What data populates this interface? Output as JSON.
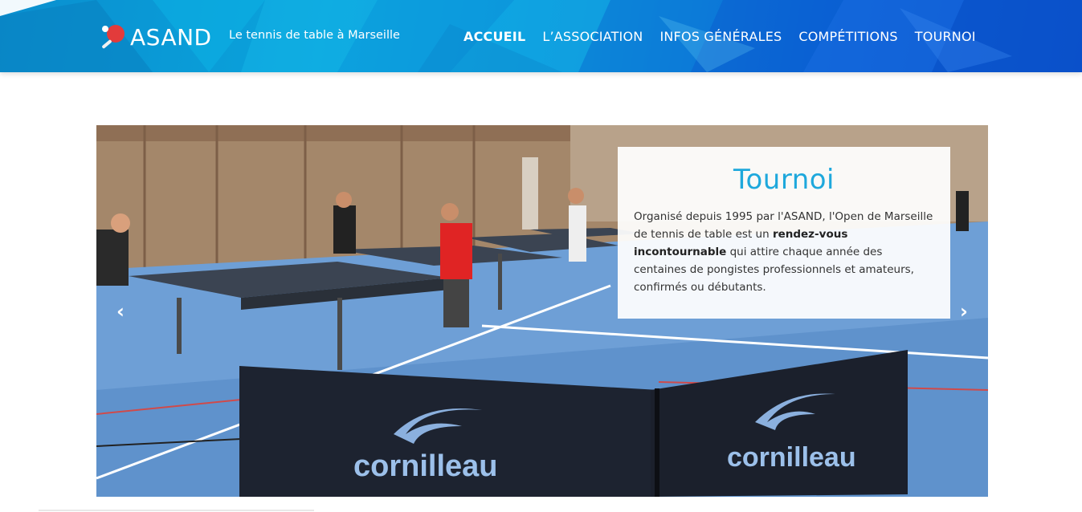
{
  "header": {
    "brand_name": "ASAND",
    "tagline": "Le tennis de table à Marseille",
    "nav": [
      {
        "label": "ACCUEIL",
        "active": true
      },
      {
        "label": "L’ASSOCIATION",
        "active": false
      },
      {
        "label": "INFOS GÉNÉRALES",
        "active": false
      },
      {
        "label": "COMPÉTITIONS",
        "active": false
      },
      {
        "label": "TOURNOI",
        "active": false
      }
    ]
  },
  "slider": {
    "caption_title": "Tournoi",
    "caption_text_1": "Organisé depuis 1995 par l'ASAND, l'Open de Marseille de tennis de table est un ",
    "caption_text_bold": "rendez-vous incontournable",
    "caption_text_2": " qui attire chaque année des centaines de pongistes professionnels et amateurs, confirmés ou débutants.",
    "prev_icon": "‹",
    "next_icon": "›",
    "barrier_brand": "cornilleau"
  },
  "icons": {
    "logo": "ping-pong-paddle-icon",
    "prev": "chevron-left-icon",
    "next": "chevron-right-icon"
  },
  "colors": {
    "header_blue": "#0a8fcf",
    "accent": "#1ea8dc",
    "court_blue": "#7fa9d6"
  }
}
